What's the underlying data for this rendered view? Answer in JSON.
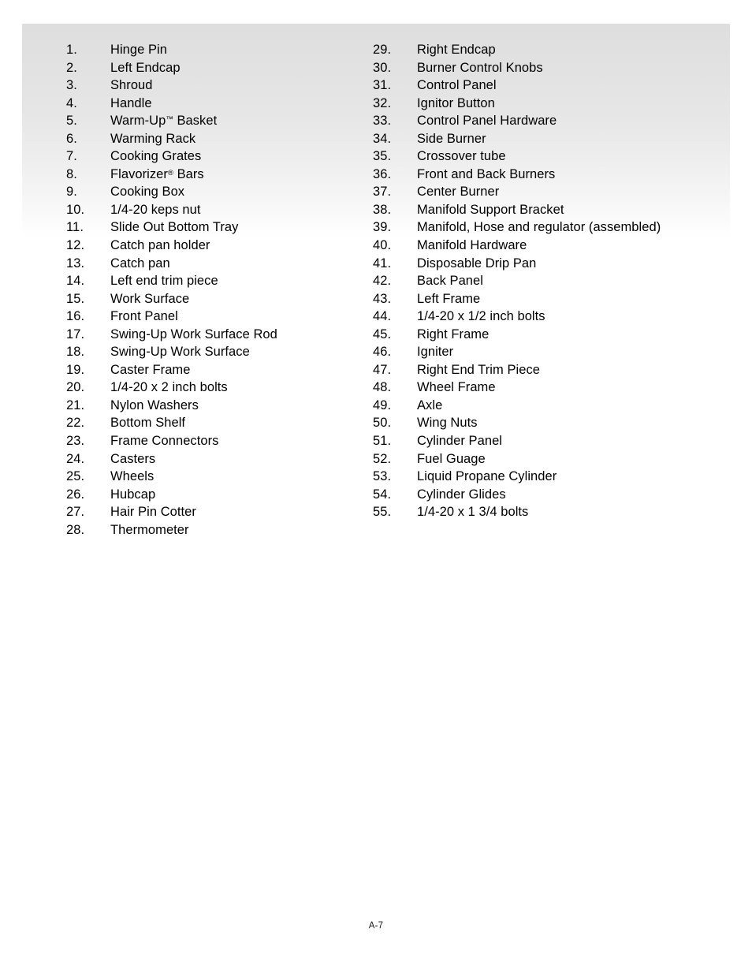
{
  "document": {
    "page_number_label": "A-7",
    "accent_shade_color": "#dedede",
    "text_color": "#000000"
  },
  "parts_list": {
    "left_column": [
      {
        "number": "1.",
        "label": "Hinge Pin"
      },
      {
        "number": "2.",
        "label": "Left Endcap"
      },
      {
        "number": "3.",
        "label": "Shroud"
      },
      {
        "number": "4.",
        "label": "Handle"
      },
      {
        "number": "5.",
        "label": "Warm-Up",
        "sup": "™",
        "label_after": " Basket",
        "full_label": "Warm-Up™ Basket"
      },
      {
        "number": "6.",
        "label": "Warming Rack"
      },
      {
        "number": "7.",
        "label": "Cooking Grates"
      },
      {
        "number": "8.",
        "label": "Flavorizer",
        "sup": "®",
        "label_after": " Bars",
        "full_label": "Flavorizer® Bars"
      },
      {
        "number": "9.",
        "label": "Cooking Box"
      },
      {
        "number": "10.",
        "label": "1/4-20 keps nut"
      },
      {
        "number": "11.",
        "label": "Slide Out Bottom Tray"
      },
      {
        "number": "12.",
        "label": "Catch pan holder"
      },
      {
        "number": "13.",
        "label": "Catch pan"
      },
      {
        "number": "14.",
        "label": "Left end trim piece"
      },
      {
        "number": "15.",
        "label": "Work Surface"
      },
      {
        "number": "16.",
        "label": "Front Panel"
      },
      {
        "number": "17.",
        "label": "Swing-Up Work Surface Rod"
      },
      {
        "number": "18.",
        "label": "Swing-Up Work Surface"
      },
      {
        "number": "19.",
        "label": "Caster Frame"
      },
      {
        "number": "20.",
        "label": "1/4-20 x 2 inch bolts"
      },
      {
        "number": "21.",
        "label": "Nylon Washers"
      },
      {
        "number": "22.",
        "label": "Bottom Shelf"
      },
      {
        "number": "23.",
        "label": "Frame Connectors"
      },
      {
        "number": "24.",
        "label": "Casters"
      },
      {
        "number": "25.",
        "label": "Wheels"
      },
      {
        "number": "26.",
        "label": "Hubcap"
      },
      {
        "number": "27.",
        "label": "Hair Pin Cotter"
      },
      {
        "number": "28.",
        "label": "Thermometer"
      }
    ],
    "right_column": [
      {
        "number": "29.",
        "label": "Right Endcap"
      },
      {
        "number": "30.",
        "label": "Burner Control Knobs"
      },
      {
        "number": "31.",
        "label": "Control Panel"
      },
      {
        "number": "32.",
        "label": "Ignitor Button"
      },
      {
        "number": "33.",
        "label": "Control Panel Hardware"
      },
      {
        "number": "34.",
        "label": "Side Burner"
      },
      {
        "number": "35.",
        "label": "Crossover tube"
      },
      {
        "number": "36.",
        "label": "Front and Back Burners"
      },
      {
        "number": "37.",
        "label": "Center Burner"
      },
      {
        "number": "38.",
        "label": "Manifold Support Bracket"
      },
      {
        "number": "39.",
        "label": "Manifold, Hose and regulator (assembled)"
      },
      {
        "number": "40.",
        "label": "Manifold Hardware"
      },
      {
        "number": "41.",
        "label": "Disposable Drip Pan"
      },
      {
        "number": "42.",
        "label": "Back Panel"
      },
      {
        "number": "43.",
        "label": "Left Frame"
      },
      {
        "number": "44.",
        "label": "1/4-20 x 1/2 inch bolts"
      },
      {
        "number": "45.",
        "label": "Right Frame"
      },
      {
        "number": "46.",
        "label": "Igniter"
      },
      {
        "number": "47.",
        "label": "Right End Trim Piece"
      },
      {
        "number": "48.",
        "label": "Wheel Frame"
      },
      {
        "number": "49.",
        "label": "Axle"
      },
      {
        "number": "50.",
        "label": "Wing Nuts"
      },
      {
        "number": "51.",
        "label": "Cylinder Panel"
      },
      {
        "number": "52.",
        "label": "Fuel Guage"
      },
      {
        "number": "53.",
        "label": "Liquid Propane Cylinder"
      },
      {
        "number": "54.",
        "label": "Cylinder Glides"
      },
      {
        "number": "55.",
        "label": "1/4-20 x 1 3/4 bolts"
      }
    ]
  }
}
